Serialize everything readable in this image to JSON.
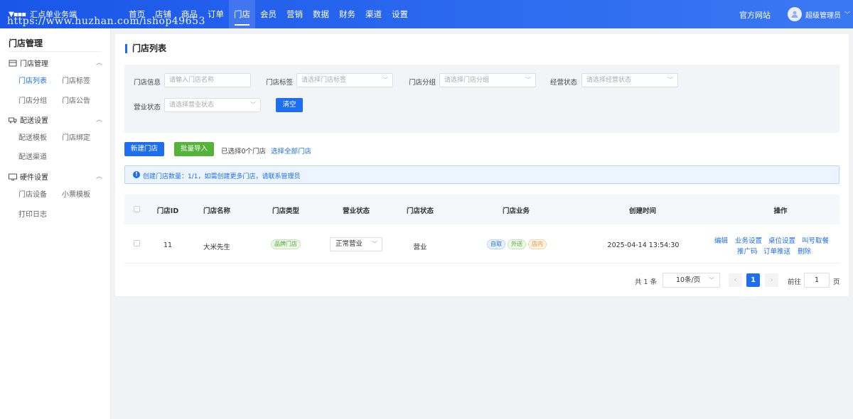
{
  "header": {
    "app_title": "汇点单业务端",
    "watermark": "https://www.huzhan.com/ishop49653",
    "nav": [
      "首页",
      "店铺",
      "商品",
      "订单",
      "门店",
      "会员",
      "营销",
      "数据",
      "财务",
      "渠道",
      "设置"
    ],
    "active_nav": "门店",
    "official_site": "官方网站",
    "user_name": "超级管理员"
  },
  "sidebar": {
    "title": "门店管理",
    "groups": [
      {
        "label": "门店管理",
        "items": [
          "门店列表",
          "门店标签",
          "门店分组",
          "门店公告"
        ]
      },
      {
        "label": "配送设置",
        "items": [
          "配送模板",
          "门店绑定",
          "配送渠道"
        ]
      },
      {
        "label": "硬件设置",
        "items": [
          "门店设备",
          "小票模板",
          "打印日志"
        ]
      }
    ],
    "active_item": "门店列表"
  },
  "page": {
    "title": "门店列表",
    "filters": {
      "store_info_label": "门店信息",
      "store_info_placeholder": "请输入门店名称",
      "tag_label": "门店标签",
      "tag_placeholder": "请选择门店标签",
      "group_label": "门店分组",
      "group_placeholder": "请选择门店分组",
      "manage_label": "经营状态",
      "manage_placeholder": "请选择经营状态",
      "biz_label": "营业状态",
      "biz_placeholder": "请选择营业状态",
      "clear_button": "清空"
    },
    "actions": {
      "new_store": "新建门店",
      "bulk_import": "批量导入",
      "selected_info": "已选择0个门店",
      "select_all": "选择全部门店"
    },
    "alert": "创建门店数量：1/1，如需创建更多门店，请联系管理员",
    "table": {
      "columns": [
        "门店ID",
        "门店名称",
        "门店类型",
        "营业状态",
        "门店状态",
        "门店业务",
        "创建时间",
        "操作"
      ],
      "rows": [
        {
          "id": "11",
          "name": "大米先生",
          "type": "品牌门店",
          "biz_status": "正常营业",
          "store_status": "营业",
          "business_tags": [
            "自取",
            "外送",
            "店内"
          ],
          "created_at": "2025-04-14 13:54:30",
          "operations": [
            "编辑",
            "业务设置",
            "桌位设置",
            "叫号取餐",
            "推广码",
            "订单推送",
            "删除"
          ]
        }
      ]
    },
    "pagination": {
      "total": "共 1 条",
      "page_size": "10条/页",
      "current_page": "1",
      "goto_label": "前往",
      "goto_value": "1",
      "goto_unit": "页"
    }
  }
}
